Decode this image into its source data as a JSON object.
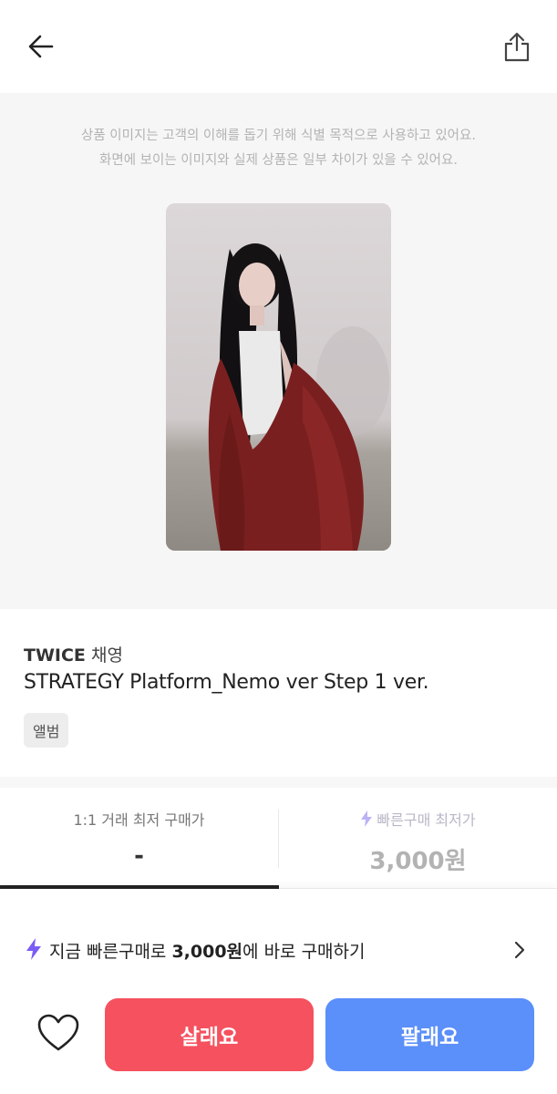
{
  "header": {
    "back_icon": "arrow-left-icon",
    "share_icon": "share-icon"
  },
  "image_area": {
    "notice_line1": "상품 이미지는 고객의 이해를 돕기 위해 식별 목적으로 사용하고 있어요.",
    "notice_line2": "화면에 보이는 이미지와 실제 상품은 일부 차이가 있을 수 있어요."
  },
  "product": {
    "artist_group": "TWICE",
    "artist_member": "채영",
    "title": "STRATEGY Platform_Nemo ver Step 1 ver.",
    "tag": "앨범"
  },
  "prices": {
    "left_label": "1:1 거래 최저 구매가",
    "left_value": "-",
    "right_label": "빠른구매 최저가",
    "right_value": "3,000원",
    "right_icon": "bolt-icon"
  },
  "quick_buy": {
    "prefix": "지금 빠른구매로 ",
    "amount": "3,000원",
    "suffix": "에 바로 구매하기",
    "icon": "bolt-icon",
    "accent": "#7b5cf5"
  },
  "actions": {
    "buy_label": "살래요",
    "sell_label": "팔래요",
    "buy_color": "#f5515f",
    "sell_color": "#5b8ff9"
  }
}
